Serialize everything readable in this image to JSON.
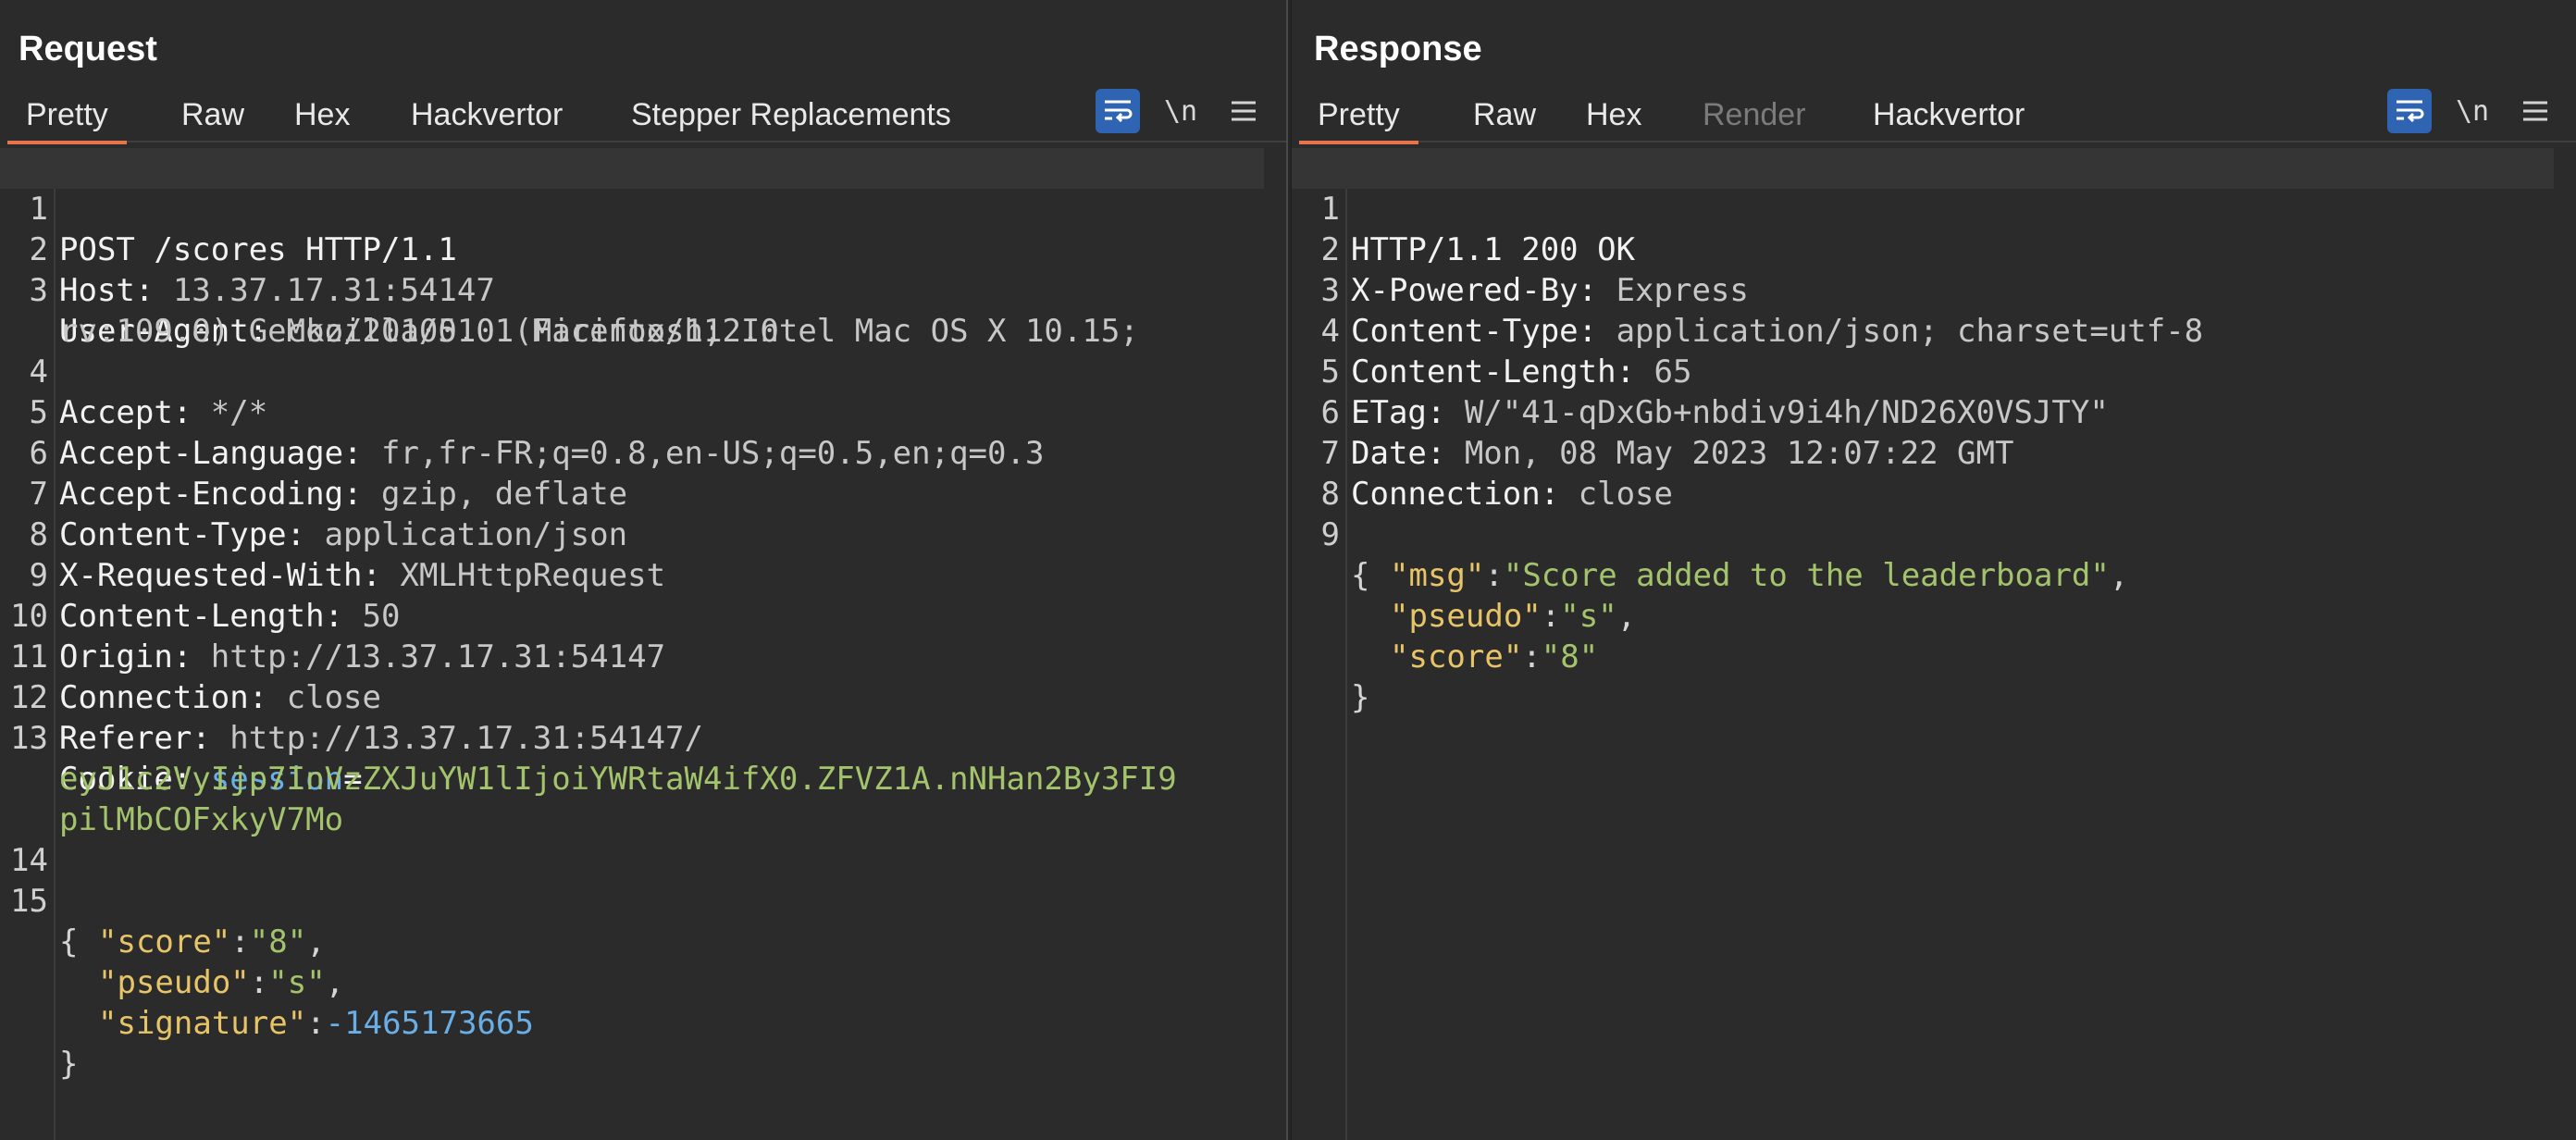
{
  "layout_switch": {
    "modes": [
      "side-by-side",
      "stacked",
      "single"
    ],
    "active": "side-by-side"
  },
  "request": {
    "title": "Request",
    "tabs": [
      "Pretty",
      "Raw",
      "Hex",
      "Hackvertor",
      "Stepper Replacements"
    ],
    "active_tab": "Pretty",
    "newline_toggle": "\\n",
    "lines": {
      "l1": {
        "num": "1",
        "text": "POST /scores HTTP/1.1"
      },
      "l2": {
        "num": "2",
        "name": "Host:",
        "value": " 13.37.17.31:54147"
      },
      "l3": {
        "num": "3",
        "name": "User-Agent:",
        "value": " Mozilla/5.0 (Macintosh; Intel Mac OS X 10.15;",
        "cont": "rv:109.0) Gecko/20100101 Firefox/112.0"
      },
      "l4": {
        "num": "4",
        "name": "Accept:",
        "value": " */*"
      },
      "l5": {
        "num": "5",
        "name": "Accept-Language:",
        "value": " fr,fr-FR;q=0.8,en-US;q=0.5,en;q=0.3"
      },
      "l6": {
        "num": "6",
        "name": "Accept-Encoding:",
        "value": " gzip, deflate"
      },
      "l7": {
        "num": "7",
        "name": "Content-Type:",
        "value": " application/json"
      },
      "l8": {
        "num": "8",
        "name": "X-Requested-With:",
        "value": " XMLHttpRequest"
      },
      "l9": {
        "num": "9",
        "name": "Content-Length:",
        "value": " 50"
      },
      "l10": {
        "num": "10",
        "name": "Origin:",
        "value": " http://13.37.17.31:54147"
      },
      "l11": {
        "num": "11",
        "name": "Connection:",
        "value": " close"
      },
      "l12": {
        "num": "12",
        "name": "Referer:",
        "value": " http://13.37.17.31:54147/"
      },
      "l13": {
        "num": "13",
        "name": "Cookie:",
        "cookie_name": " session",
        "eq": "=",
        "cookie_val1": "eyJ1c2VyIjp7InVzZXJuYW1lIjoiYWRtaW4ifX0.ZFVZ1A.nNHan2By3FI9",
        "cookie_val2": "pilMbCOFxkyV7Mo"
      },
      "l14": {
        "num": "14"
      },
      "l15": {
        "num": "15",
        "text": "{"
      },
      "j1": {
        "key": "\"score\"",
        "colon": ":",
        "val": "\"8\"",
        "comma": ","
      },
      "j2": {
        "key": "\"pseudo\"",
        "colon": ":",
        "val": "\"s\"",
        "comma": ","
      },
      "j3": {
        "key": "\"signature\"",
        "colon": ":",
        "val": "-1465173665"
      },
      "close": "}"
    }
  },
  "response": {
    "title": "Response",
    "tabs": [
      "Pretty",
      "Raw",
      "Hex",
      "Render",
      "Hackvertor"
    ],
    "active_tab": "Pretty",
    "newline_toggle": "\\n",
    "lines": {
      "l1": {
        "num": "1",
        "text": "HTTP/1.1 200 OK"
      },
      "l2": {
        "num": "2",
        "name": "X-Powered-By:",
        "value": " Express"
      },
      "l3": {
        "num": "3",
        "name": "Content-Type:",
        "value": " application/json; charset=utf-8"
      },
      "l4": {
        "num": "4",
        "name": "Content-Length:",
        "value": " 65"
      },
      "l5": {
        "num": "5",
        "name": "ETag:",
        "value": " W/\"41-qDxGb+nbdiv9i4h/ND26X0VSJTY\""
      },
      "l6": {
        "num": "6",
        "name": "Date:",
        "value": " Mon, 08 May 2023 12:07:22 GMT"
      },
      "l7": {
        "num": "7",
        "name": "Connection:",
        "value": " close"
      },
      "l8": {
        "num": "8"
      },
      "l9": {
        "num": "9",
        "text": "{"
      },
      "j1": {
        "key": "\"msg\"",
        "colon": ":",
        "val": "\"Score added to the leaderboard\"",
        "comma": ","
      },
      "j2": {
        "key": "\"pseudo\"",
        "colon": ":",
        "val": "\"s\"",
        "comma": ","
      },
      "j3": {
        "key": "\"score\"",
        "colon": ":",
        "val": "\"8\""
      },
      "close": "}"
    }
  },
  "colors": {
    "accent_tab": "#e8744c",
    "toggle_active": "#2f64b3",
    "json_key": "#e6c467",
    "json_string": "#a3c46c",
    "json_number": "#6aaee6",
    "background": "#2b2b2b"
  }
}
